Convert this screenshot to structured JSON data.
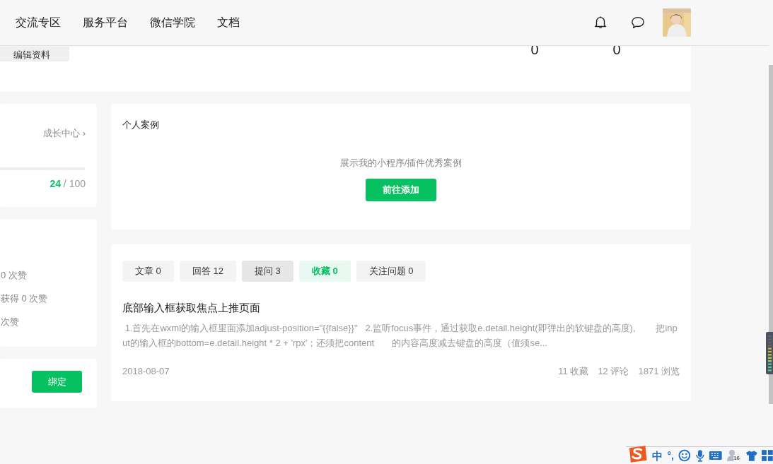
{
  "nav": {
    "links": [
      "交流专区",
      "服务平台",
      "微信学院",
      "文档"
    ]
  },
  "profile": {
    "edit_button": "编辑资料",
    "counts": [
      "0",
      "0"
    ]
  },
  "growth": {
    "link": "成长中心 ›",
    "score": "24",
    "total": " / 100"
  },
  "likes": {
    "lines": [
      "0 次赞",
      "获得 0 次赞",
      "次赞"
    ]
  },
  "bind": {
    "button": "绑定"
  },
  "cases": {
    "title": "个人案例",
    "hint": "展示我的小程序/插件优秀案例",
    "button": "前往添加"
  },
  "tabs": [
    {
      "label": "文章 0",
      "selected": false,
      "hovered": false
    },
    {
      "label": "回答 12",
      "selected": false,
      "hovered": false
    },
    {
      "label": "提问 3",
      "selected": false,
      "hovered": true
    },
    {
      "label": "收藏 0",
      "selected": true,
      "hovered": false
    },
    {
      "label": "关注问题 0",
      "selected": false,
      "hovered": false
    }
  ],
  "post": {
    "title": "底部输入框获取焦点上推页面",
    "excerpt": " 1.首先在wxml的输入框里面添加adjust-position=\"{{false}}\"   2.监听focus事件，通过获取e.detail.height(即弹出的软键盘的高度),        把input的输入框的bottom=e.detail.height * 2 + 'rpx'；还须把content       的内容高度减去键盘的高度（值须se...",
    "date": "2018-08-07",
    "stats": [
      "11 收藏",
      "12 评论",
      "1871 浏览"
    ]
  },
  "ime_toolbar": {
    "mode": "中",
    "punctuation": "°,",
    "badge": "16"
  }
}
